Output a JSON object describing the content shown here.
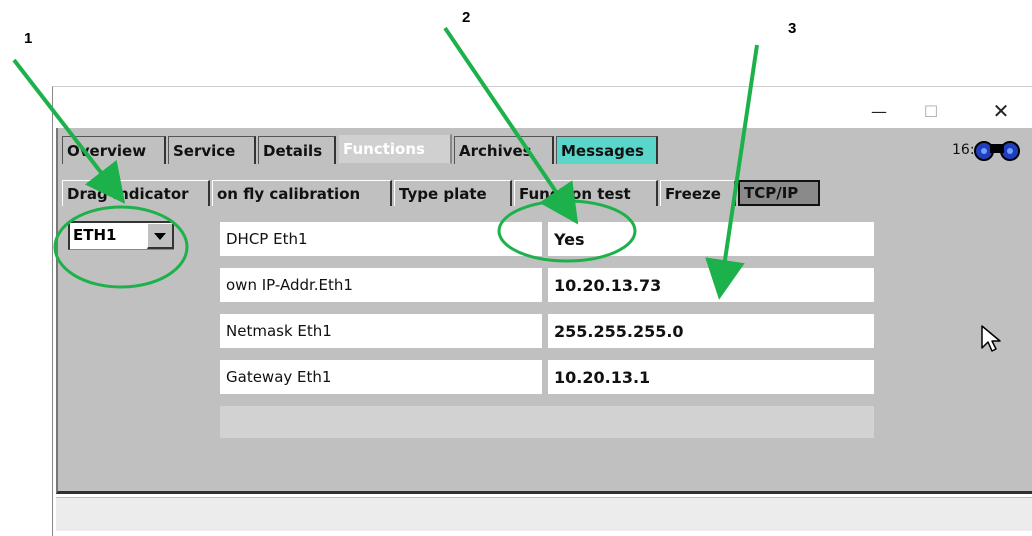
{
  "callouts": [
    "1",
    "2",
    "3"
  ],
  "window": {
    "controls": {
      "minimize": "—",
      "maximize": "☐",
      "close": "✕"
    },
    "clock_text": "16:"
  },
  "tabs": [
    {
      "label": "Overview"
    },
    {
      "label": "Service"
    },
    {
      "label": "Details"
    },
    {
      "label": "Functions",
      "active": true
    },
    {
      "label": "Archives"
    },
    {
      "label": "Messages",
      "highlight": "#59d6c9"
    }
  ],
  "subtabs": [
    {
      "label": "Drag indicator"
    },
    {
      "label": "on fly calibration"
    },
    {
      "label": "Type plate"
    },
    {
      "label": "Function test"
    },
    {
      "label": "Freeze"
    },
    {
      "label": "TCP/IP",
      "active": true
    }
  ],
  "interface_select": {
    "value": "ETH1"
  },
  "settings": [
    {
      "label": "DHCP Eth1",
      "value": "Yes"
    },
    {
      "label": "own IP-Addr.Eth1",
      "value": "10.20.13.73"
    },
    {
      "label": "Netmask Eth1",
      "value": "255.255.255.0"
    },
    {
      "label": "Gateway Eth1",
      "value": "10.20.13.1"
    }
  ],
  "annotation_color": "#1db14b",
  "icons": [
    "binoculars-icon",
    "chevron-down-icon",
    "mouse-cursor-icon"
  ]
}
